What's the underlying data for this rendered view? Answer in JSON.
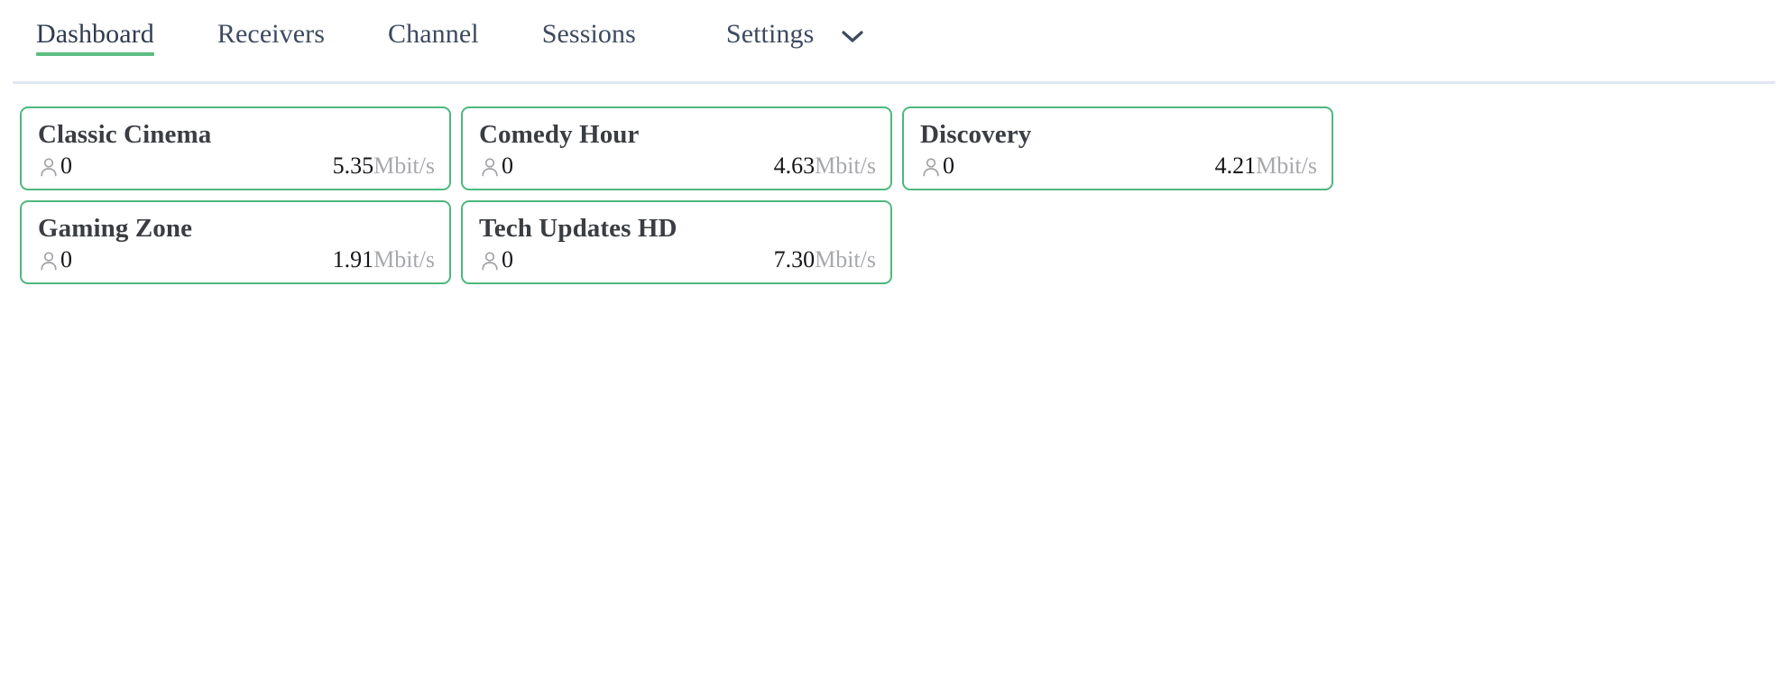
{
  "nav": {
    "items": [
      {
        "label": "Dashboard",
        "active": true
      },
      {
        "label": "Receivers",
        "active": false
      },
      {
        "label": "Channel",
        "active": false
      },
      {
        "label": "Sessions",
        "active": false
      }
    ],
    "settings": {
      "label": "Settings",
      "chevron_icon": "chevron-down-icon"
    }
  },
  "colors": {
    "accent_green": "#4db87d",
    "underline_green": "#5bbd82",
    "nav_text": "#3d4a60",
    "title_text": "#3a3d42",
    "muted_text": "#a7a9ad",
    "divider": "#e2e8f0"
  },
  "cards": {
    "viewer_icon": "person-icon",
    "unit": "Mbit/s",
    "items": [
      {
        "title": "Classic Cinema",
        "viewers": "0",
        "bitrate": "5.35",
        "unit": "Mbit/s"
      },
      {
        "title": "Comedy Hour",
        "viewers": "0",
        "bitrate": "4.63",
        "unit": "Mbit/s"
      },
      {
        "title": "Discovery",
        "viewers": "0",
        "bitrate": "4.21",
        "unit": "Mbit/s"
      },
      {
        "title": "Gaming Zone",
        "viewers": "0",
        "bitrate": "1.91",
        "unit": "Mbit/s"
      },
      {
        "title": "Tech Updates HD",
        "viewers": "0",
        "bitrate": "7.30",
        "unit": "Mbit/s"
      }
    ]
  }
}
